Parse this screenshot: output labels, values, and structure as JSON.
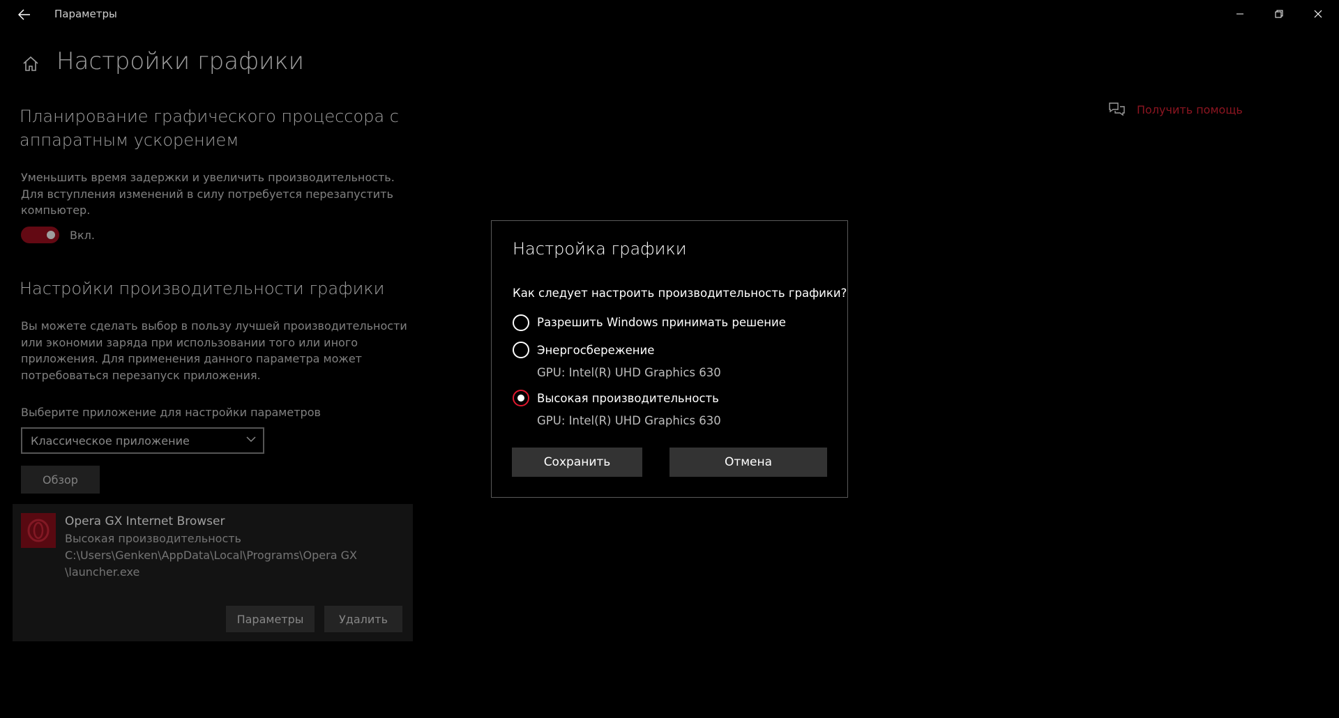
{
  "window": {
    "title": "Параметры"
  },
  "page": {
    "title": "Настройки графики",
    "help_link": "Получить помощь"
  },
  "gpu_scheduling": {
    "title": "Планирование графического процессора с аппаратным ускорением",
    "description": "Уменьшить время задержки и увеличить производительность. Для вступления изменений в силу потребуется перезапустить компьютер.",
    "toggle_on": true,
    "toggle_label": "Вкл."
  },
  "performance": {
    "title": "Настройки производительности графики",
    "description": "Вы можете сделать выбор в пользу лучшей производительности или экономии заряда при использовании того или иного приложения. Для применения данного параметра может потребоваться перезапуск приложения.",
    "select_label": "Выберите приложение для настройки параметров",
    "select_value": "Классическое приложение",
    "browse_label": "Обзор"
  },
  "app_entry": {
    "name": "Opera GX Internet Browser",
    "preference": "Высокая производительность",
    "path_line1": "C:\\Users\\Genken\\AppData\\Local\\Programs\\Opera GX",
    "path_line2": "\\launcher.exe",
    "params_label": "Параметры",
    "delete_label": "Удалить"
  },
  "dialog": {
    "title": "Настройка графики",
    "question": "Как следует настроить производительность графики?",
    "options": [
      {
        "label": "Разрешить Windows принимать решение",
        "gpu": "",
        "selected": false
      },
      {
        "label": "Энергосбережение",
        "gpu": "GPU: Intel(R) UHD Graphics 630",
        "selected": false
      },
      {
        "label": "Высокая производительность",
        "gpu": "GPU: Intel(R) UHD Graphics 630",
        "selected": true
      }
    ],
    "save_label": "Сохранить",
    "cancel_label": "Отмена"
  },
  "colors": {
    "accent": "#e0182e",
    "toggle_fill": "#a0101f",
    "help_link": "#e02235",
    "background": "#000000"
  }
}
